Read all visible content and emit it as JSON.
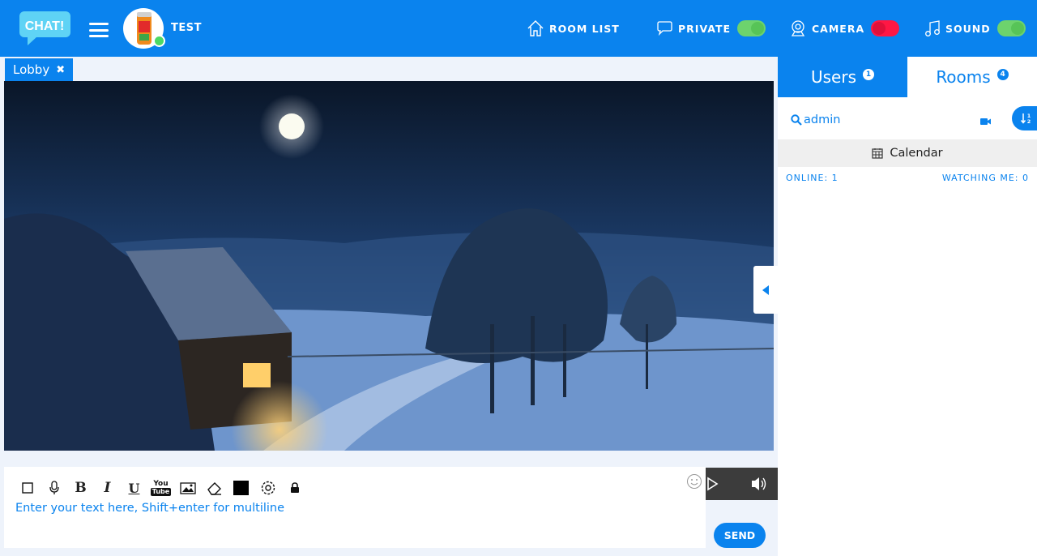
{
  "app": {
    "logo_text": "CHAT!"
  },
  "user": {
    "name": "TEST"
  },
  "nav": {
    "room_list": "ROOM LIST",
    "private": "PRIVATE",
    "camera": "CAMERA",
    "sound": "SOUND"
  },
  "toggles": {
    "private": {
      "on": true,
      "color": "#6dd36d"
    },
    "camera": {
      "on": false,
      "color": "#ff1744"
    },
    "sound": {
      "on": true,
      "color": "#6dd36d"
    }
  },
  "room_tab": {
    "label": "Lobby",
    "close_glyph": "✖"
  },
  "composer": {
    "placeholder": "Enter your text here, Shift+enter for multiline",
    "tools": [
      "square-icon",
      "microphone-icon",
      "bold-icon",
      "italic-icon",
      "underline-icon",
      "youtube-icon",
      "image-icon",
      "eraser-icon",
      "color-swatch",
      "settings-icon",
      "lock-icon"
    ],
    "bold": "B",
    "italic": "I",
    "underline": "U",
    "youtube_top": "You",
    "youtube_bottom": "Tube",
    "text_color": "#000000",
    "send": "SEND"
  },
  "sidebar": {
    "tabs": [
      {
        "label": "Users",
        "count": "1",
        "active": true
      },
      {
        "label": "Rooms",
        "count": "4",
        "active": false
      }
    ],
    "search_value": "admin",
    "calendar": "Calendar",
    "online": "ONLINE: 1",
    "watching": "WATCHING ME: 0"
  },
  "colors": {
    "brand": "#0a83ee",
    "page_bg": "#eef3fb"
  }
}
